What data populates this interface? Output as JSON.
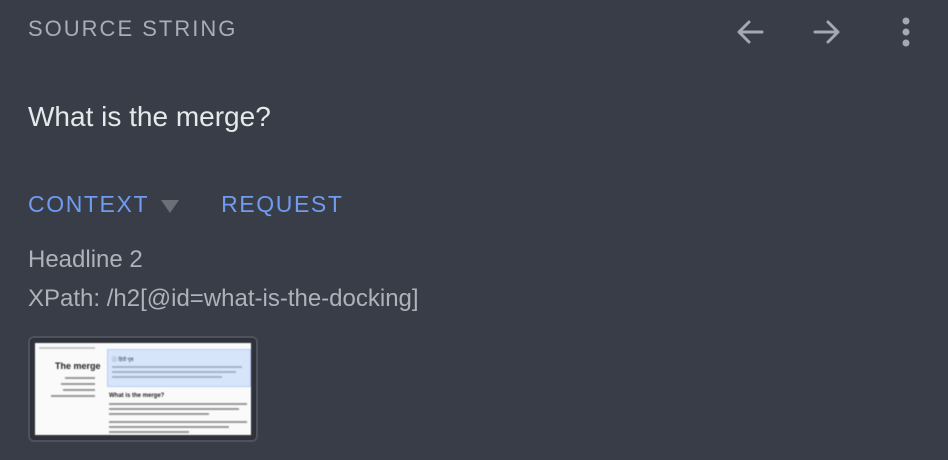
{
  "header": {
    "label": "SOURCE STRING",
    "icons": [
      "arrow-left-icon",
      "arrow-right-icon",
      "more-vertical-icon"
    ]
  },
  "source": {
    "text": "What is the merge?"
  },
  "tabs": {
    "context_label": "CONTEXT",
    "request_label": "REQUEST"
  },
  "context": {
    "element_type": "Headline 2",
    "xpath": "XPath: /h2[@id=what-is-the-docking]"
  },
  "screenshot": {
    "page_title": "The merge",
    "callout_title": "ⓘ हिंदी पृष्ठ",
    "section_heading": "What is the merge?"
  },
  "colors": {
    "background": "#393d48",
    "accent": "#6f9cf0",
    "muted_text": "#a9adb5",
    "primary_text": "#e6e8eb"
  }
}
